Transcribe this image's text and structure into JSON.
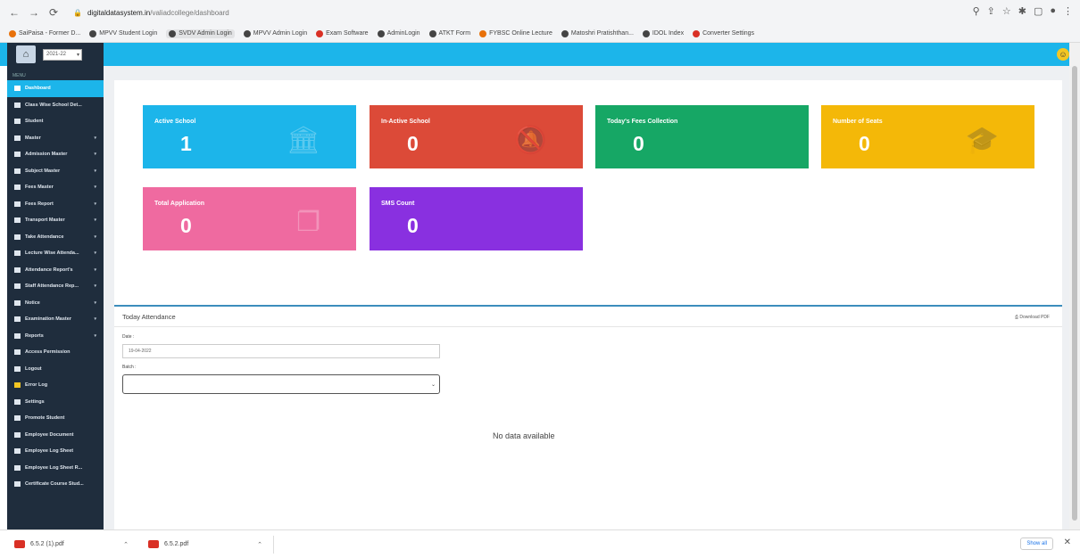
{
  "browser": {
    "url_host": "digitaldatasystem.in",
    "url_path": "/valiadcollege/dashboard",
    "bookmarks": [
      {
        "label": "SaiPaisa - Former D...",
        "icon": "orange"
      },
      {
        "label": "MPVV Student Login",
        "icon": "dark"
      },
      {
        "label": "SVDV Admin Login",
        "icon": "dark",
        "selected": true
      },
      {
        "label": "MPVV Admin Login",
        "icon": "dark"
      },
      {
        "label": "Exam Software",
        "icon": "red"
      },
      {
        "label": "AdminLogin",
        "icon": "dark"
      },
      {
        "label": "ATKT Form",
        "icon": "dark"
      },
      {
        "label": "FYBSC Online Lecture",
        "icon": "orange"
      },
      {
        "label": "Matoshri Pratishthan...",
        "icon": "dark"
      },
      {
        "label": "IDOL Index",
        "icon": "dark"
      },
      {
        "label": "Converter Settings",
        "icon": "red"
      }
    ]
  },
  "header": {
    "year": "2021-22"
  },
  "sidebar": {
    "caption": "MENU",
    "items": [
      {
        "label": "Dashboard",
        "active": true,
        "caret": false
      },
      {
        "label": "Class Wise School Det...",
        "caret": false
      },
      {
        "label": "Student",
        "caret": false
      },
      {
        "label": "Master",
        "caret": true
      },
      {
        "label": "Admission Master",
        "caret": true
      },
      {
        "label": "Subject Master",
        "caret": true
      },
      {
        "label": "Fees Master",
        "caret": true
      },
      {
        "label": "Fees Report",
        "caret": true
      },
      {
        "label": "Transport Master",
        "caret": true
      },
      {
        "label": "Take Attendance",
        "caret": true
      },
      {
        "label": "Lecture Wise Attenda...",
        "caret": true
      },
      {
        "label": "Attendance Report's",
        "caret": true
      },
      {
        "label": "Staff Attendance Rep...",
        "caret": true
      },
      {
        "label": "Notice",
        "caret": true
      },
      {
        "label": "Examination Master",
        "caret": true
      },
      {
        "label": "Reports",
        "caret": true
      },
      {
        "label": "Access Permission",
        "caret": false
      },
      {
        "label": "Logout",
        "caret": false
      },
      {
        "label": "Error Log",
        "caret": false,
        "warn": true
      },
      {
        "label": "Settings",
        "caret": false
      },
      {
        "label": "Promote Student",
        "caret": false
      },
      {
        "label": "Employee Document",
        "caret": false
      },
      {
        "label": "Employee Log Sheet",
        "caret": false
      },
      {
        "label": "Employee Log Sheet R...",
        "caret": false
      },
      {
        "label": "Certificate Course Stud...",
        "caret": false
      }
    ]
  },
  "cards": [
    {
      "title": "Active School",
      "value": "1",
      "color": "#1cb5ea",
      "icon": "bank-icon"
    },
    {
      "title": "In-Active School",
      "value": "0",
      "color": "#dc4a38",
      "icon": "no-bell-icon"
    },
    {
      "title": "Today's Fees Collection",
      "value": "0",
      "color": "#16a765",
      "icon": "money-icon"
    },
    {
      "title": "Number of Seats",
      "value": "0",
      "color": "#f4b808",
      "icon": "graduation-cap-icon"
    },
    {
      "title": "Total Application",
      "value": "0",
      "color": "#ef6aa0",
      "icon": "copy-icon"
    },
    {
      "title": "SMS Count",
      "value": "0",
      "color": "#8930e0",
      "icon": "message-icon"
    }
  ],
  "attendance": {
    "title": "Today Attendance",
    "download": "Download PDF",
    "date_label": "Date :",
    "date_value": "19-04-2022",
    "batch_label": "Batch :",
    "no_data": "No data available"
  },
  "downloads": {
    "items": [
      "6.5.2 (1).pdf",
      "6.5.2.pdf"
    ],
    "show_all": "Show all"
  }
}
